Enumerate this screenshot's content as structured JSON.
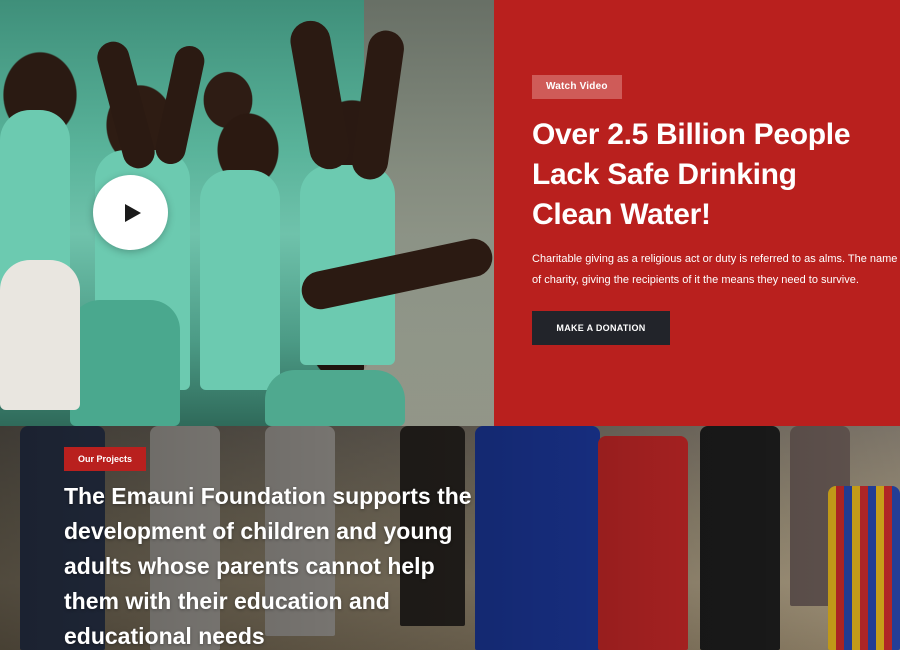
{
  "hero": {
    "badge": "Watch Video",
    "title_lines": [
      "Over 2.5 Billion People",
      "Lack Safe Drinking",
      "Clean Water!"
    ],
    "description_lines": [
      "Charitable giving as a religious act or duty is referred to as alms. The name s",
      "of charity, giving the recipients of it the means they need to survive."
    ],
    "donate_label": "MAKE A DONATION",
    "play_icon": "play-icon"
  },
  "projects": {
    "badge": "Our Projects",
    "title_lines": [
      "The Emauni Foundation supports the",
      "development of children and young",
      "adults whose parents cannot help",
      "them with their education and",
      "educational needs"
    ]
  },
  "colors": {
    "brand_red": "#b9201e",
    "badge_light_red": "#cf5b58",
    "button_dark": "#22242a"
  }
}
